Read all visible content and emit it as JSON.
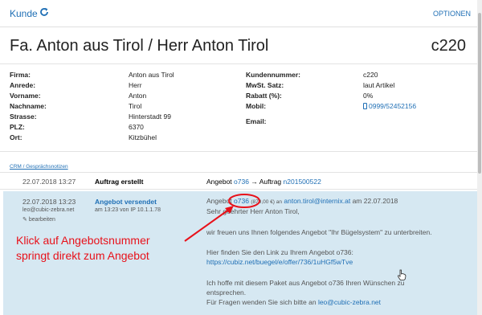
{
  "topbar": {
    "title": "Kunde",
    "options": "OPTIONEN",
    "refresh_icon": "refresh-icon"
  },
  "header": {
    "name": "Fa. Anton aus Tirol / Herr Anton Tirol",
    "customer_code": "c220"
  },
  "left_fields": [
    {
      "label": "Firma:",
      "value": "Anton aus Tirol"
    },
    {
      "label": "Anrede:",
      "value": "Herr"
    },
    {
      "label": "Vorname:",
      "value": "Anton"
    },
    {
      "label": "Nachname:",
      "value": "Tirol"
    },
    {
      "label": "Strasse:",
      "value": "Hinterstadt 99"
    },
    {
      "label": "PLZ:",
      "value": "6370"
    },
    {
      "label": "Ort:",
      "value": "Kitzbühel"
    }
  ],
  "right_fields": [
    {
      "label": "Kundennummer:",
      "value": "c220"
    },
    {
      "label": "MwSt. Satz:",
      "value": "laut Artikel"
    },
    {
      "label": "Rabatt (%):",
      "value": "0%"
    },
    {
      "label": "Mobil:",
      "value": "0999/52452156",
      "icon": "phone-icon"
    },
    {
      "label": "Email:",
      "value": ""
    }
  ],
  "crm_link": "CRM / Gesprächsnotizen",
  "events": [
    {
      "date": "22.07.2018 13:27",
      "title": "Auftrag erstellt",
      "text_prefix": "Angebot",
      "offer_link": "o736",
      "arrow": "→",
      "text_mid": "Auftrag",
      "order_link": "n201500522"
    },
    {
      "date": "22.07.2018 13:23",
      "user": "leo@cubic-zebra.net",
      "edit_label": "bearbeiten",
      "title": "Angebot versendet",
      "subtitle": "am 13:23 von IP 10.1.1.78",
      "line1_prefix": "Angebot",
      "line1_link": "o736",
      "line1_amount": "(879,00 €) an",
      "line1_email": "anton.tirol@internix.at",
      "line1_suffix": "am 22.07.2018",
      "greeting": "Sehr geehrter Herr Anton Tirol,",
      "body1": "wir freuen uns Ihnen folgendes Angebot \"Ihr Bügelsystem\" zu unterbreiten.",
      "body2": "Hier finden Sie den Link zu Ihrem Angebot o736:",
      "link_url": "https://cubiz.net/buegel/e/offer/736/1uHGf5wTve",
      "body3a": "Ich hoffe mit diesem Paket aus Angebot o736 Ihren Wünschen zu",
      "body3b": "entsprechen.",
      "body4_prefix": "Für Fragen wenden Sie sich bitte an",
      "body4_email": "leo@cubic-zebra.net"
    }
  ],
  "annotation": {
    "line1": "Klick auf Angebotsnummer",
    "line2": "springt direkt zum Angebot",
    "color": "#e8111a"
  }
}
